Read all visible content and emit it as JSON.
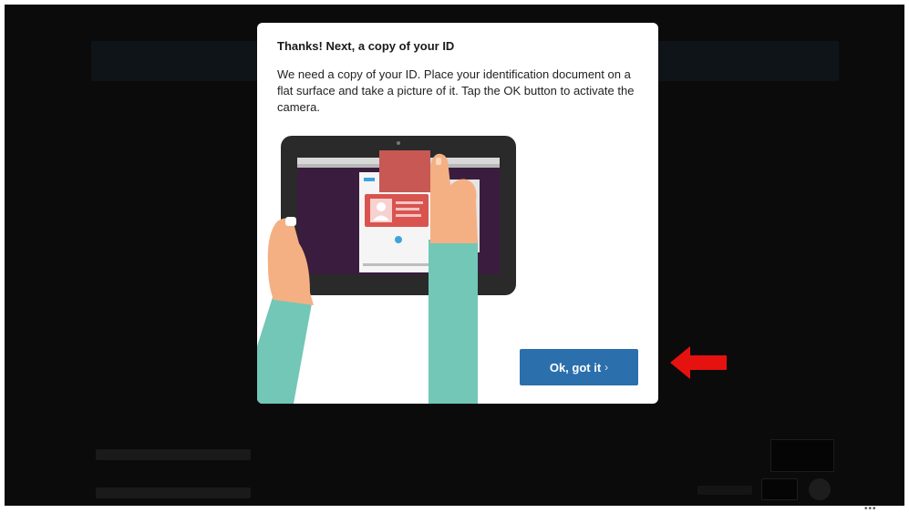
{
  "dialog": {
    "title": "Thanks! Next, a copy of your ID",
    "body": "We need a copy of your ID. Place your identification document on a flat surface and take a picture of it. Tap the OK button to activate the camera.",
    "ok_button": {
      "label": "Ok, got it",
      "chevron": "›"
    }
  },
  "icons": {
    "illustration": "hands-tablet-id-capture-illustration",
    "arrow": "red-left-arrow-icon"
  },
  "colors": {
    "backdrop": "#0b0b0b",
    "dialog_bg": "#ffffff",
    "button_bg": "#2c6fad",
    "arrow": "#e5120f",
    "skin": "#f4b083",
    "sleeve": "#72c7b7",
    "id_card": "#d9534f",
    "tablet": "#2a2a2a"
  }
}
